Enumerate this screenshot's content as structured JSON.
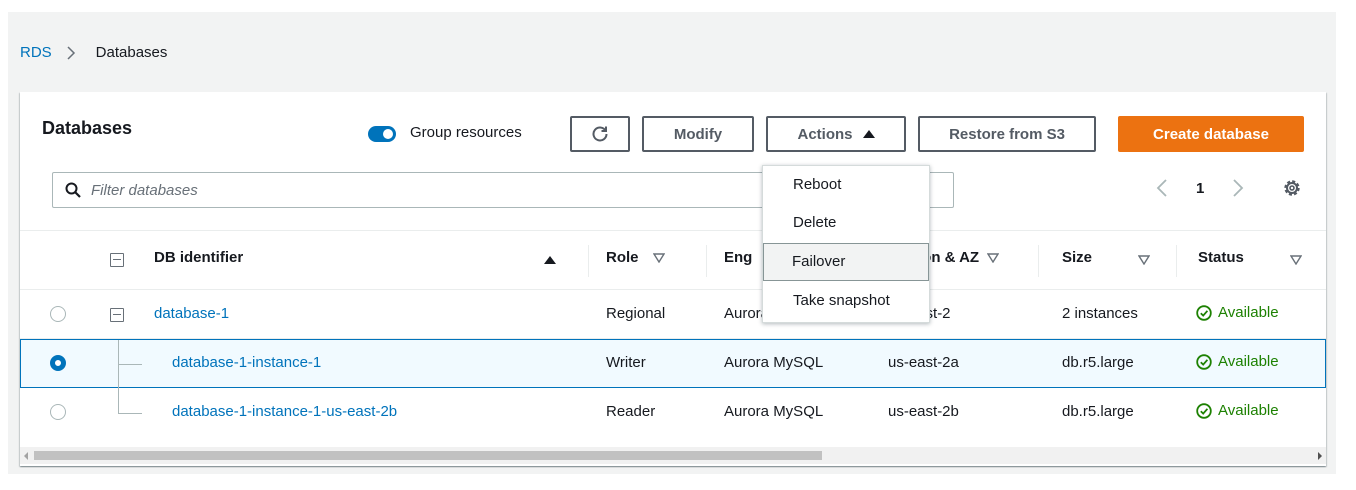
{
  "breadcrumb": {
    "root": "RDS",
    "current": "Databases"
  },
  "panel": {
    "title": "Databases",
    "group_resources_label": "Group resources",
    "buttons": {
      "modify": "Modify",
      "actions": "Actions",
      "restore": "Restore from S3",
      "create": "Create database"
    },
    "search_placeholder": "Filter databases",
    "page_number": "1"
  },
  "columns": {
    "db_identifier": "DB identifier",
    "role": "Role",
    "engine": "Eng",
    "region_az": "ion & AZ",
    "size": "Size",
    "status": "Status"
  },
  "rows": [
    {
      "id": "database-1",
      "role": "Regional",
      "engine": "Aurora MySQL",
      "region": "us-east-2",
      "size": "2 instances",
      "status": "Available",
      "selected": false
    },
    {
      "id": "database-1-instance-1",
      "role": "Writer",
      "engine": "Aurora MySQL",
      "region": "us-east-2a",
      "size": "db.r5.large",
      "status": "Available",
      "selected": true
    },
    {
      "id": "database-1-instance-1-us-east-2b",
      "role": "Reader",
      "engine": "Aurora MySQL",
      "region": "us-east-2b",
      "size": "db.r5.large",
      "status": "Available",
      "selected": false
    }
  ],
  "actions_menu": {
    "items": [
      "Reboot",
      "Delete",
      "Failover",
      "Take snapshot"
    ],
    "highlighted": "Failover"
  },
  "colors": {
    "link": "#0073bb",
    "primary_button": "#ec7211",
    "available": "#1d8102",
    "selected_row_bg": "#f1faff"
  },
  "icons": {
    "refresh": "refresh-icon",
    "search": "search-icon",
    "settings": "gear-icon",
    "status": "check-circle-icon"
  }
}
